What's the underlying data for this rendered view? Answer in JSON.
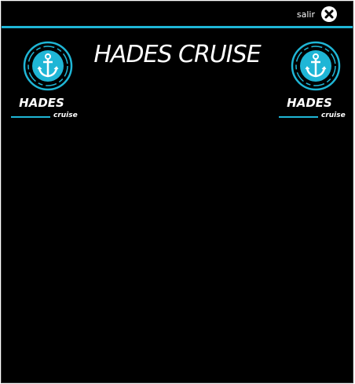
{
  "window": {
    "exit_label": "salir",
    "title": "HADES CRUISE"
  },
  "colors": {
    "accent": "#1fb6d6",
    "background": "#000000",
    "text": "#ffffff"
  },
  "logos": [
    {
      "name": "HADES",
      "tagline": "cruise",
      "icon": "anchor-icon"
    },
    {
      "name": "HADES",
      "tagline": "cruise",
      "icon": "anchor-icon"
    }
  ],
  "icons": {
    "close": "close-icon"
  }
}
